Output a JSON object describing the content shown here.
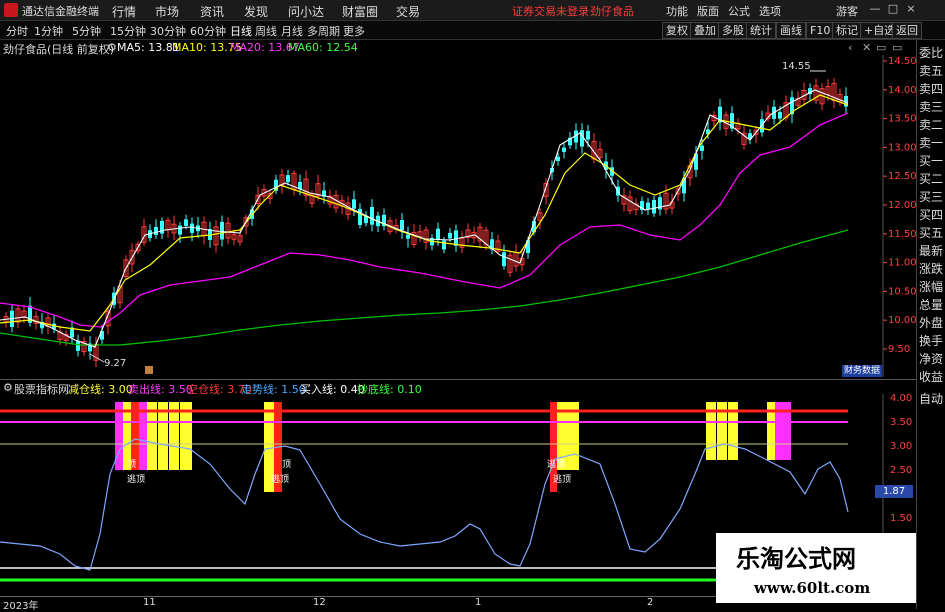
{
  "app": {
    "name": "通达信金融终端"
  },
  "menu": [
    "行情",
    "市场",
    "资讯",
    "发现",
    "问小达",
    "财富圈",
    "交易"
  ],
  "warning": "证券交易未登录",
  "stock_name_top": "劲仔食品",
  "top_right_menu": [
    "功能",
    "版面",
    "公式",
    "选项"
  ],
  "login_label": "游客",
  "window_buttons": [
    "—",
    "□",
    "×"
  ],
  "periods": [
    "分时",
    "1分钟",
    "5分钟",
    "15分钟",
    "30分钟",
    "60分钟",
    "日线",
    "周线",
    "月线",
    "多周期",
    "更多"
  ],
  "active_period": "日线",
  "toolbar_right": [
    "复权",
    "叠加",
    "多股",
    "统计",
    "画线",
    "F10",
    "标记",
    "+自选",
    "返回"
  ],
  "ma_info": {
    "title": "劲仔食品(日线 前复权)",
    "ma5": "MA5: 13.81",
    "ma10": "MA10: 13.75",
    "ma20": "MA20: 13.67",
    "ma60": "MA60: 12.54"
  },
  "price_axis": [
    "14.50",
    "14.00",
    "13.50",
    "13.00",
    "12.50",
    "12.00",
    "11.50",
    "11.00",
    "10.50",
    "10.00",
    "9.50"
  ],
  "price_annotations": {
    "high": "14.55",
    "low": "9.27"
  },
  "badge": "财务数据",
  "indicator_info": {
    "name": "股票指标网",
    "items": [
      {
        "label": "减仓线: 3.00",
        "color": "#ffff3c"
      },
      {
        "label": "卖出线: 3.50",
        "color": "#ff3cff"
      },
      {
        "label": "空仓线: 3.70",
        "color": "#ff3c3c"
      },
      {
        "label": "走势线: 1.50",
        "color": "#4ea8ff"
      },
      {
        "label": "买入线: 0.40",
        "color": "#ffffff"
      },
      {
        "label": "抄底线: 0.10",
        "color": "#3cff3c"
      }
    ]
  },
  "indicator_axis": [
    "4.00",
    "3.50",
    "3.00",
    "2.50",
    "2.00",
    "1.50"
  ],
  "current_value": "1.87",
  "signal_labels": [
    "顶",
    "顶",
    "顶",
    "顶",
    "逃顶",
    "逃顶",
    "逃顶",
    "逃顶"
  ],
  "x_axis": [
    "2023年",
    "11",
    "12",
    "1",
    "2"
  ],
  "right_panel": [
    "委比",
    "卖五",
    "卖四",
    "卖三",
    "卖二",
    "卖一",
    "买一",
    "买二",
    "买三",
    "买四",
    "买五",
    "最新",
    "涨跌",
    "涨幅",
    "总量",
    "外盘",
    "换手",
    "净资",
    "收益",
    "自动"
  ],
  "watermark": {
    "cn": "乐淘公式网",
    "url": "www.60lt.com"
  },
  "colors": {
    "up": "#ff3c3c",
    "down": "#3cffff",
    "ma5": "#ffffff",
    "ma10": "#ffff00",
    "ma20": "#ff00ff",
    "ma60": "#00c000"
  }
}
